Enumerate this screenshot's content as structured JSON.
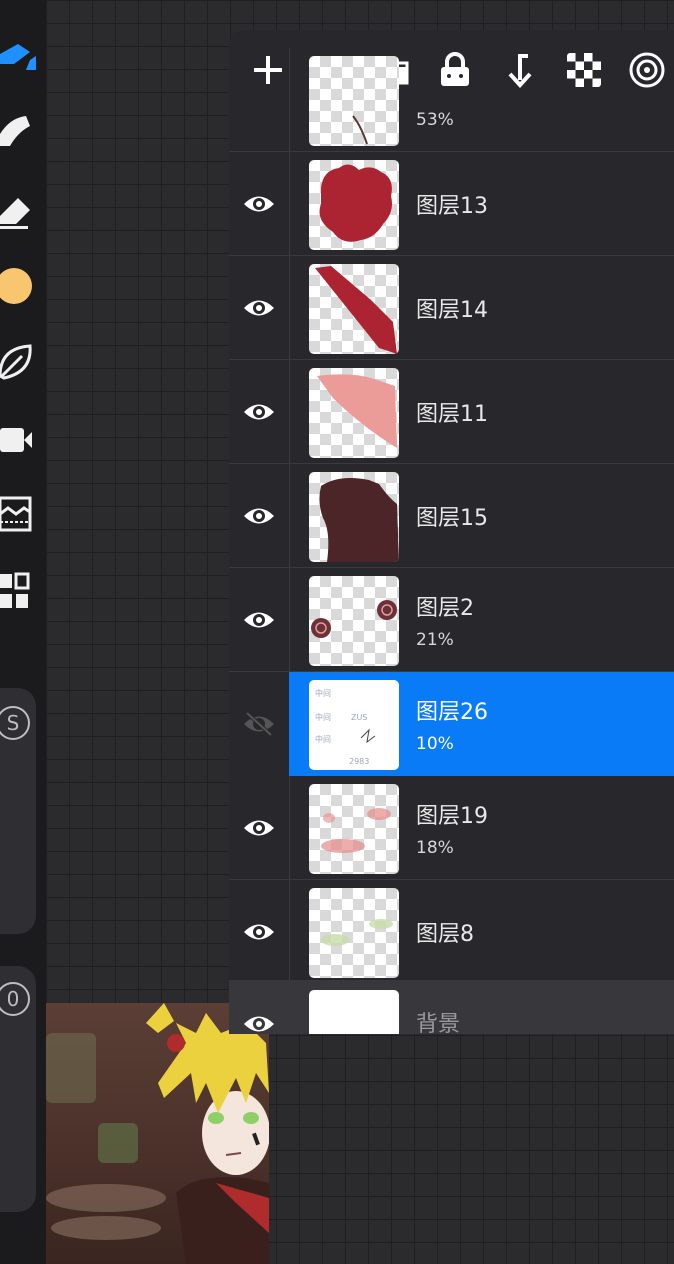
{
  "toolbar": {
    "tools": [
      "brush-icon",
      "smudge-icon",
      "eraser-icon",
      "color-swatch",
      "leaf-icon",
      "video-icon",
      "image-adjust-icon",
      "gallery-grid-icon"
    ],
    "color_swatch": "#f8c66f",
    "accent": "#1e90ff",
    "size_slider_label": "S",
    "opacity_slider_label": "0"
  },
  "panel": {
    "toolbar_icons": [
      "add-icon",
      "folder-icon",
      "lock-icon",
      "merge-down-icon",
      "checkerboard-icon",
      "target-icon"
    ],
    "layers": [
      {
        "name": "",
        "opacity": "53%",
        "visible": true
      },
      {
        "name": "图层13",
        "opacity": "",
        "visible": true
      },
      {
        "name": "图层14",
        "opacity": "",
        "visible": true
      },
      {
        "name": "图层11",
        "opacity": "",
        "visible": true
      },
      {
        "name": "图层15",
        "opacity": "",
        "visible": true
      },
      {
        "name": "图层2",
        "opacity": "21%",
        "visible": true
      },
      {
        "name": "图层26",
        "opacity": "10%",
        "visible": false,
        "selected": true
      },
      {
        "name": "图层19",
        "opacity": "18%",
        "visible": true
      },
      {
        "name": "图层8",
        "opacity": "",
        "visible": true
      },
      {
        "name": "背景",
        "opacity": "",
        "visible": true
      }
    ],
    "selected_color": "#0a7bf6"
  }
}
